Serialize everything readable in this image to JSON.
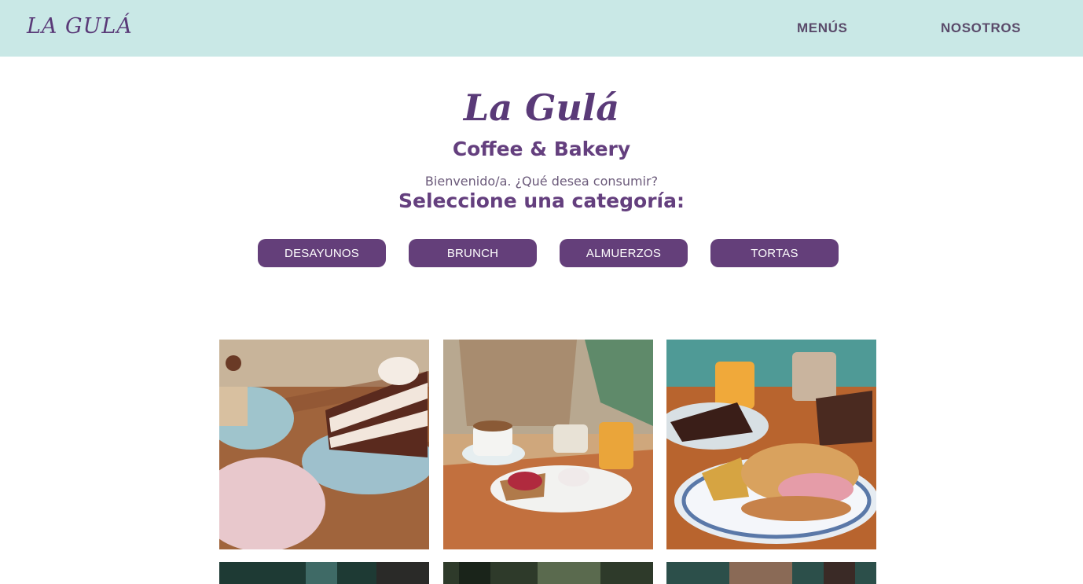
{
  "navbar": {
    "brand": "LA GULÁ",
    "links": [
      "MENÚS",
      "NOSOTROS"
    ]
  },
  "hero": {
    "title": "La Gulá",
    "subtitle": "Coffee & Bakery",
    "welcome": "Bienvenido/a. ¿Qué desea consumir?",
    "prompt": "Seleccione una categoría:"
  },
  "categories": [
    "DESAYUNOS",
    "BRUNCH",
    "ALMUERZOS",
    "TORTAS"
  ],
  "colors": {
    "navbar_bg": "#c9e8e6",
    "accent_purple": "#643f7a",
    "button_text": "#ffffff"
  }
}
